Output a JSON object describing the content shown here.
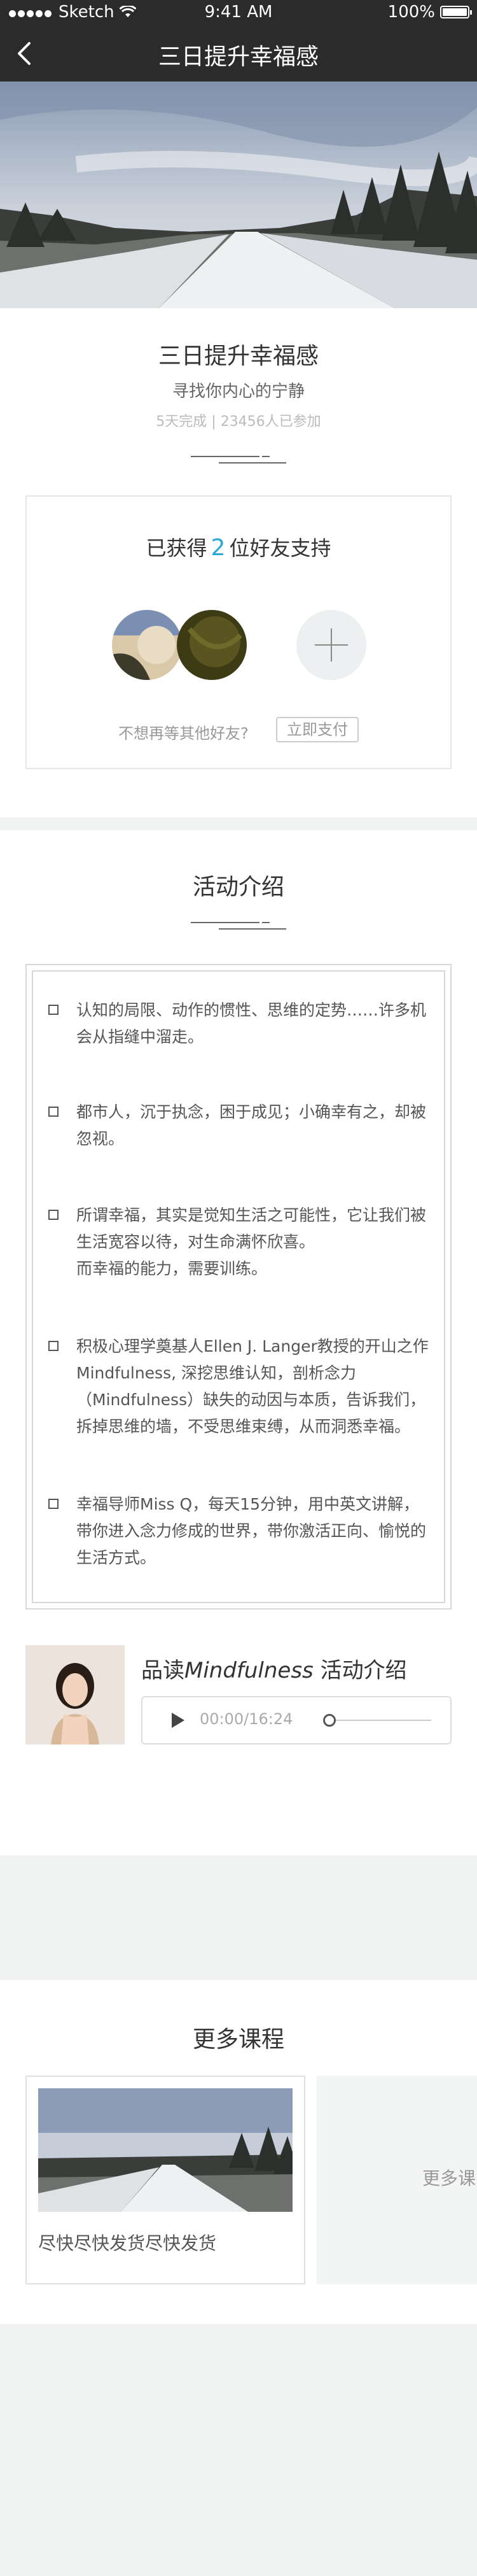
{
  "status_bar": {
    "carrier": "Sketch",
    "time": "9:41 AM",
    "battery": "100%"
  },
  "nav": {
    "title": "三日提升幸福感"
  },
  "intro": {
    "title": "三日提升幸福感",
    "subtitle": "寻找你内心的宁静",
    "meta": "5天完成 | 23456人已参加"
  },
  "support": {
    "prefix": "已获得",
    "count": "2",
    "suffix": "位好友支持",
    "prompt": "不想再等其他好友?",
    "pay_label": "立即支付"
  },
  "activity": {
    "title": "活动介绍",
    "items": [
      "认知的局限、动作的惯性、思维的定势……许多机会从指缝中溜走。",
      "都市人，沉于执念，困于成见；小确幸有之，却被忽视。",
      "所谓幸福，其实是觉知生活之可能性，它让我们被生活宽容以待，对生命满怀欣喜。\n而幸福的能力，需要训练。",
      "积极心理学奠基人Ellen J. Langer教授的开山之作Mindfulness, 深挖思维认知，剖析念力（Mindfulness）缺失的动因与本质，告诉我们，拆掉思维的墙，不受思维束缚，从而洞悉幸福。",
      "幸福导师Miss Q，每天15分钟，用中英文讲解，带你进入念力修成的世界，带你激活正向、愉悦的生活方式。"
    ]
  },
  "audio": {
    "title_prefix": "品读",
    "title_italic": "Mindfulness",
    "title_suffix": " 活动介绍",
    "time": "00:00/16:24",
    "progress": 0
  },
  "more_courses": {
    "title": "更多课程",
    "items": [
      {
        "name": "尽快尽快发货尽快发货"
      }
    ],
    "more_label": "更多课"
  }
}
